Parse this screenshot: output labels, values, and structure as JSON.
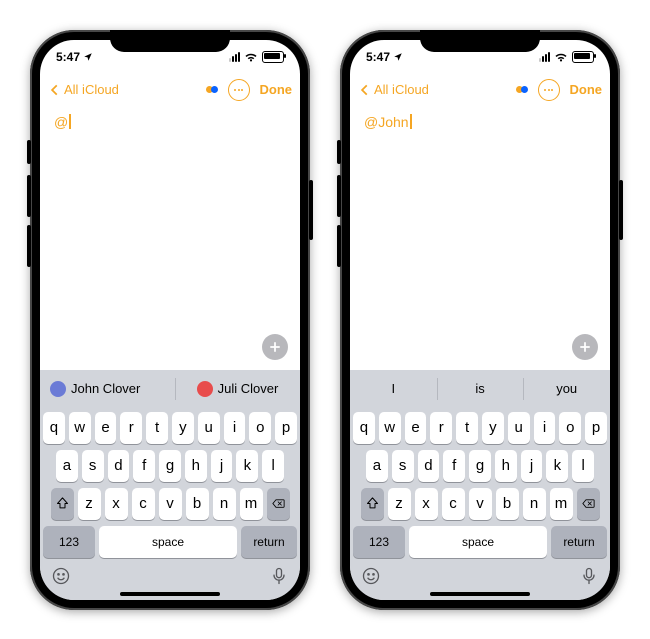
{
  "status": {
    "time": "5:47"
  },
  "nav": {
    "back_label": "All iCloud",
    "done_label": "Done"
  },
  "phones": {
    "left": {
      "note_text": "@",
      "suggestions": [
        {
          "name": "John Clover",
          "avatar": "john"
        },
        {
          "name": "Juli Clover",
          "avatar": "juli"
        }
      ]
    },
    "right": {
      "note_text": "@John",
      "suggestions": [
        {
          "word": "I"
        },
        {
          "word": "is"
        },
        {
          "word": "you"
        }
      ]
    }
  },
  "keyboard": {
    "row1": [
      "q",
      "w",
      "e",
      "r",
      "t",
      "y",
      "u",
      "i",
      "o",
      "p"
    ],
    "row2": [
      "a",
      "s",
      "d",
      "f",
      "g",
      "h",
      "j",
      "k",
      "l"
    ],
    "row3": [
      "z",
      "x",
      "c",
      "v",
      "b",
      "n",
      "m"
    ],
    "numbers_label": "123",
    "space_label": "space",
    "return_label": "return"
  }
}
